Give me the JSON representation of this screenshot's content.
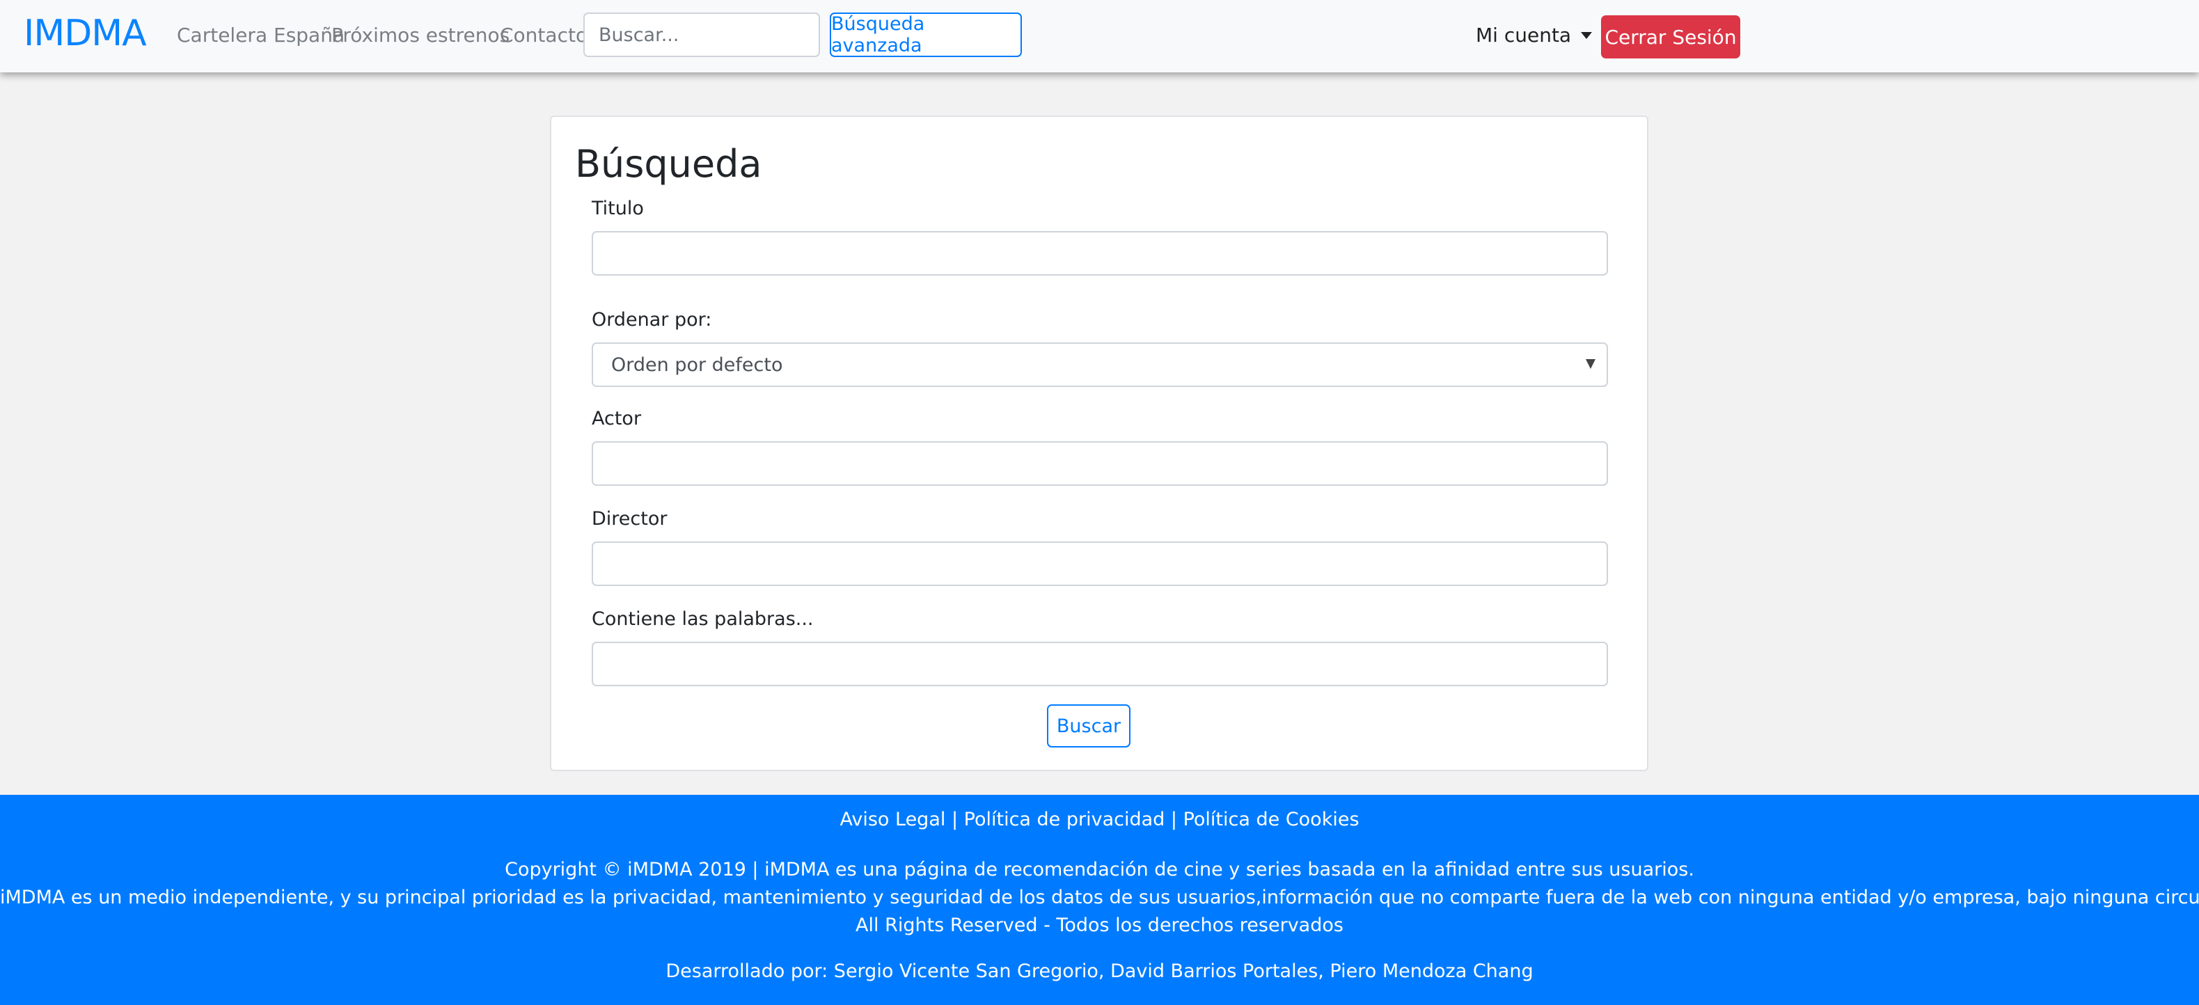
{
  "header": {
    "brand": "IMDMA",
    "nav": [
      "Cartelera España",
      "Próximos estrenos",
      "Contacto"
    ],
    "search_placeholder": "Buscar...",
    "advanced_search_label": "Búsqueda avanzada",
    "account_label": "Mi cuenta",
    "logout_label": "Cerrar Sesión"
  },
  "form": {
    "title": "Búsqueda",
    "title_label": "Titulo",
    "title_value": "",
    "order_label": "Ordenar por:",
    "order_selected": "Orden por defecto",
    "actor_label": "Actor",
    "actor_value": "",
    "director_label": "Director",
    "director_value": "",
    "words_label": "Contiene las palabras...",
    "words_value": "",
    "submit_label": "Buscar"
  },
  "footer": {
    "links": [
      "Aviso Legal",
      "Política de privacidad",
      "Política de Cookies"
    ],
    "separator": " | ",
    "copyright": "Copyright © iMDMA 2019 | iMDMA es una página de recomendación de cine y series basada en la afinidad entre sus usuarios.",
    "privacy": "iMDMA es un medio independiente, y su principal prioridad es la privacidad, mantenimiento y seguridad de los datos de sus usuarios,información que no comparte fuera de la web con ninguna entidad y/o empresa, bajo ninguna circunstancia.",
    "rights": "All Rights Reserved - Todos los derechos reservados",
    "developers": "Desarrollado por: Sergio Vicente San Gregorio, David Barrios Portales, Piero Mendoza Chang"
  },
  "colors": {
    "primary": "#007bff",
    "danger": "#dc3545",
    "navbar_bg": "#f8f9fa",
    "page_bg": "#f2f2f2"
  }
}
